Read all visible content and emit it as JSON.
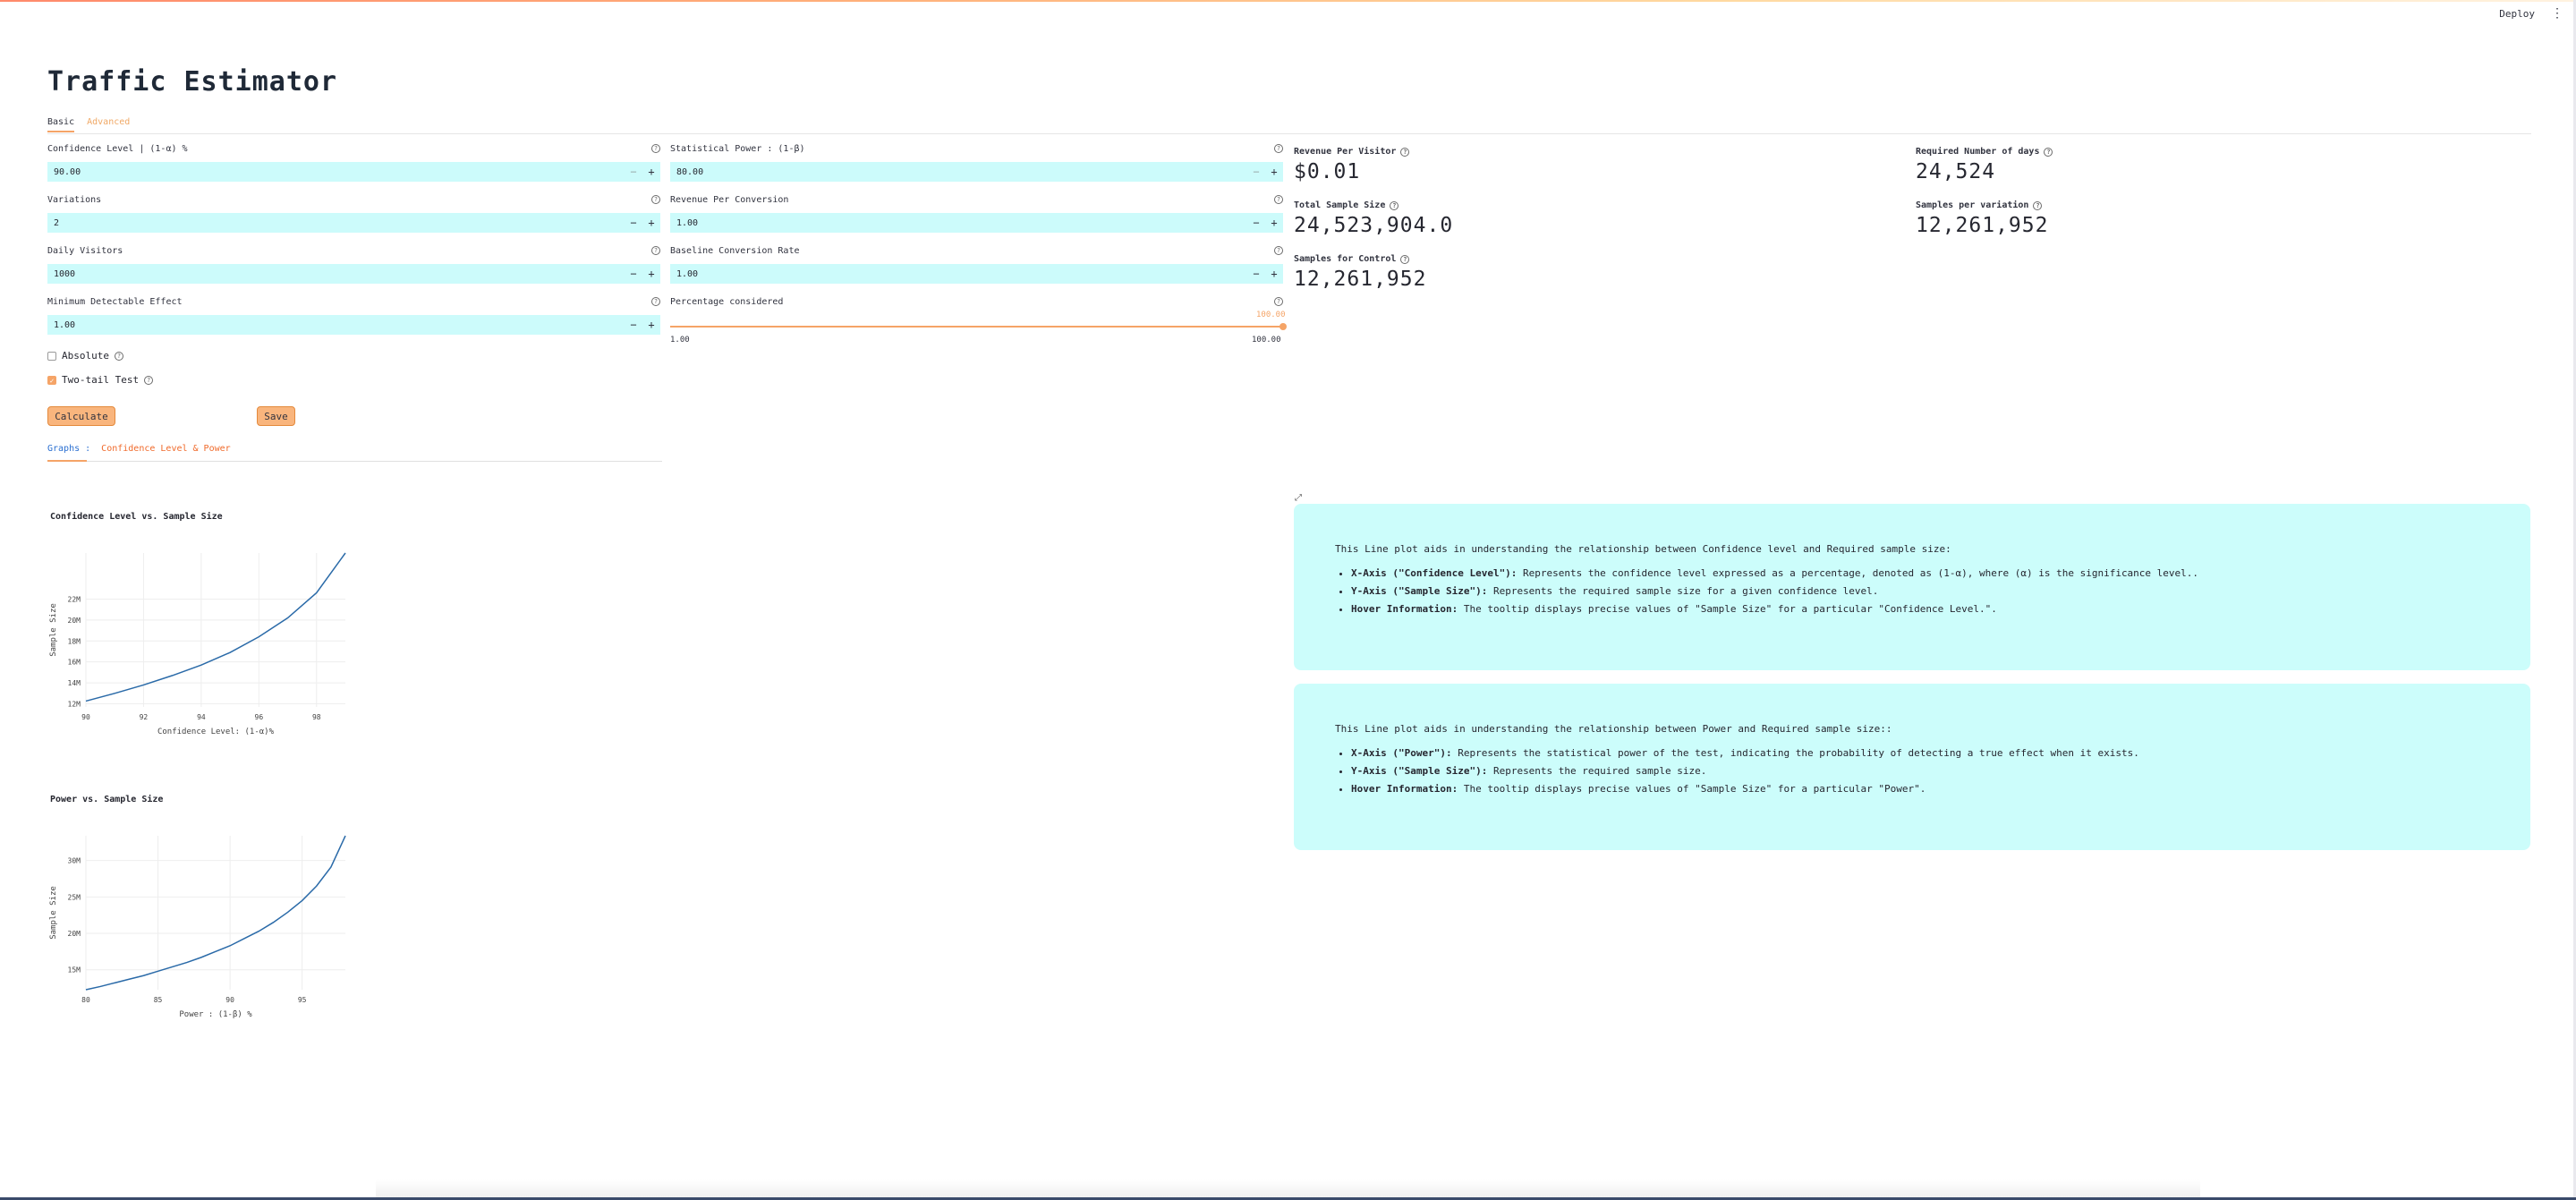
{
  "header": {
    "deploy_label": "Deploy",
    "menu_icon": "kebab-menu-icon"
  },
  "app": {
    "title": "Traffic Estimator"
  },
  "tabs": [
    {
      "label": "Basic",
      "active": true
    },
    {
      "label": "Advanced",
      "active": false
    }
  ],
  "inputs": {
    "confidence": {
      "label": "Confidence Level | (1-α) %",
      "value": "90.00"
    },
    "power": {
      "label": "Statistical Power : (1-β)",
      "value": "80.00"
    },
    "variations": {
      "label": "Variations",
      "value": "2"
    },
    "revenue_conversion": {
      "label": "Revenue Per Conversion",
      "value": "1.00"
    },
    "daily_visitors": {
      "label": "Daily Visitors",
      "value": "1000"
    },
    "baseline": {
      "label": "Baseline Conversion Rate",
      "value": "1.00"
    },
    "mde": {
      "label": "Minimum Detectable Effect",
      "value": "1.00"
    },
    "percentage": {
      "label": "Percentage considered",
      "value": "100.00",
      "value_fraction": 1.0,
      "min": "1.00",
      "max": "100.00"
    }
  },
  "stepper": {
    "minus": "−",
    "plus": "+"
  },
  "help_glyph": "?",
  "checkboxes": {
    "absolute": {
      "label": "Absolute",
      "checked": false
    },
    "two_tail": {
      "label": "Two-tail Test",
      "checked": true,
      "mark": "✓"
    }
  },
  "buttons": {
    "calculate": "Calculate",
    "save": "Save"
  },
  "metrics": {
    "revenue_per_visitor": {
      "label": "Revenue Per Visitor",
      "value": "$0.01"
    },
    "required_days": {
      "label": "Required Number of days",
      "value": "24,524"
    },
    "total_sample": {
      "label": "Total Sample Size",
      "value": "24,523,904.0"
    },
    "samples_per_variation": {
      "label": "Samples per variation",
      "value": "12,261,952"
    },
    "samples_control": {
      "label": "Samples for Control",
      "value": "12,261,952"
    }
  },
  "graph_tabs": {
    "graphs": "Graphs :",
    "conf_power": "Confidence Level & Power"
  },
  "fullscreen_icon": "⤢",
  "chart_data": [
    {
      "type": "line",
      "title": "Confidence Level vs. Sample Size",
      "xlabel": "Confidence Level: (1-α)%",
      "ylabel": "Sample Size",
      "x": [
        90,
        91,
        92,
        93,
        94,
        95,
        96,
        97,
        98,
        99
      ],
      "y": [
        12.26,
        13.0,
        13.8,
        14.7,
        15.7,
        16.9,
        18.4,
        20.2,
        22.6,
        26.4
      ],
      "y_unit": "M",
      "xlim": [
        90,
        99
      ],
      "ylim": [
        11.7,
        26.4
      ],
      "xticks": [
        "90",
        "92",
        "94",
        "96",
        "98"
      ],
      "yticks": [
        "12M",
        "14M",
        "16M",
        "18M",
        "20M",
        "22M"
      ],
      "grid": true
    },
    {
      "type": "line",
      "title": "Power vs. Sample Size",
      "xlabel": "Power : (1-β) %",
      "ylabel": "Sample Size",
      "x": [
        80,
        81,
        82,
        83,
        84,
        85,
        86,
        87,
        88,
        89,
        90,
        91,
        92,
        93,
        94,
        95,
        96,
        97,
        98
      ],
      "y": [
        12.26,
        12.7,
        13.2,
        13.7,
        14.2,
        14.8,
        15.4,
        16.0,
        16.7,
        17.5,
        18.3,
        19.3,
        20.3,
        21.5,
        22.9,
        24.5,
        26.5,
        29.1,
        33.4
      ],
      "y_unit": "M",
      "xlim": [
        80,
        98
      ],
      "ylim": [
        12.26,
        33.4
      ],
      "xticks": [
        "80",
        "85",
        "90",
        "95"
      ],
      "yticks": [
        "15M",
        "20M",
        "25M",
        "30M"
      ],
      "grid": true
    }
  ],
  "info_boxes": {
    "confidence": {
      "intro": "This Line plot aids in understanding the relationship between Confidence level and Required sample size:",
      "items": [
        {
          "term": "X-Axis (\"Confidence Level\"):",
          "text": " Represents the confidence level expressed as a percentage, denoted as (1-α), where (α) is the significance level.."
        },
        {
          "term": "Y-Axis (\"Sample Size\"):",
          "text": " Represents the required sample size for a given confidence level."
        },
        {
          "term": "Hover Information:",
          "text": " The tooltip displays precise values of \"Sample Size\" for a particular \"Confidence Level.\"."
        }
      ]
    },
    "power": {
      "intro": "This Line plot aids in understanding the relationship between Power and Required sample size::",
      "items": [
        {
          "term": "X-Axis (\"Power\"):",
          "text": " Represents the statistical power of the test, indicating the probability of detecting a true effect when it exists."
        },
        {
          "term": "Y-Axis (\"Sample Size\"):",
          "text": " Represents the required sample size."
        },
        {
          "term": "Hover Information:",
          "text": " The tooltip displays precise values of \"Sample Size\" for a particular \"Power\"."
        }
      ]
    }
  }
}
